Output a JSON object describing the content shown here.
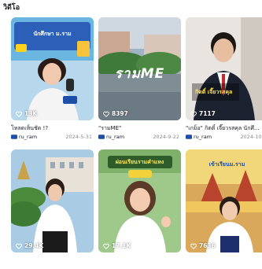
{
  "section": {
    "title": "วิดีโอ"
  },
  "cards": [
    {
      "views": "13K",
      "caption": "โหลดเห็นชัด !?",
      "author": "ru_ram",
      "date": "2024-5-31",
      "thumb_text": "นักศึกษา ม.ราม"
    },
    {
      "views": "8397",
      "caption": "\"รามME\"",
      "author": "ru_ram",
      "date": "2024-9-22",
      "thumb_text": "รามME"
    },
    {
      "views": "7117",
      "caption": "\"เกม็อ\" กิตติ์ เจี๊ยวรสคุล นักศึ...",
      "author": "ru_ram",
      "date": "2024-10-2",
      "thumb_text": "กิตติ์ เจี๊ยวรสคุล"
    },
    {
      "views": "29.4K",
      "caption": "",
      "author": "",
      "date": ""
    },
    {
      "views": "17.1K",
      "caption": "",
      "author": "",
      "date": "",
      "thumb_text": "ผ่อนเรียนรามคำแหง"
    },
    {
      "views": "7636",
      "caption": "",
      "author": "",
      "date": "",
      "thumb_text": "เข้าเรียนม.ราม"
    }
  ],
  "colors": {
    "accent": "#fe2c55",
    "ru_badge": "#1e4fa8",
    "date": "#8a8b91"
  }
}
